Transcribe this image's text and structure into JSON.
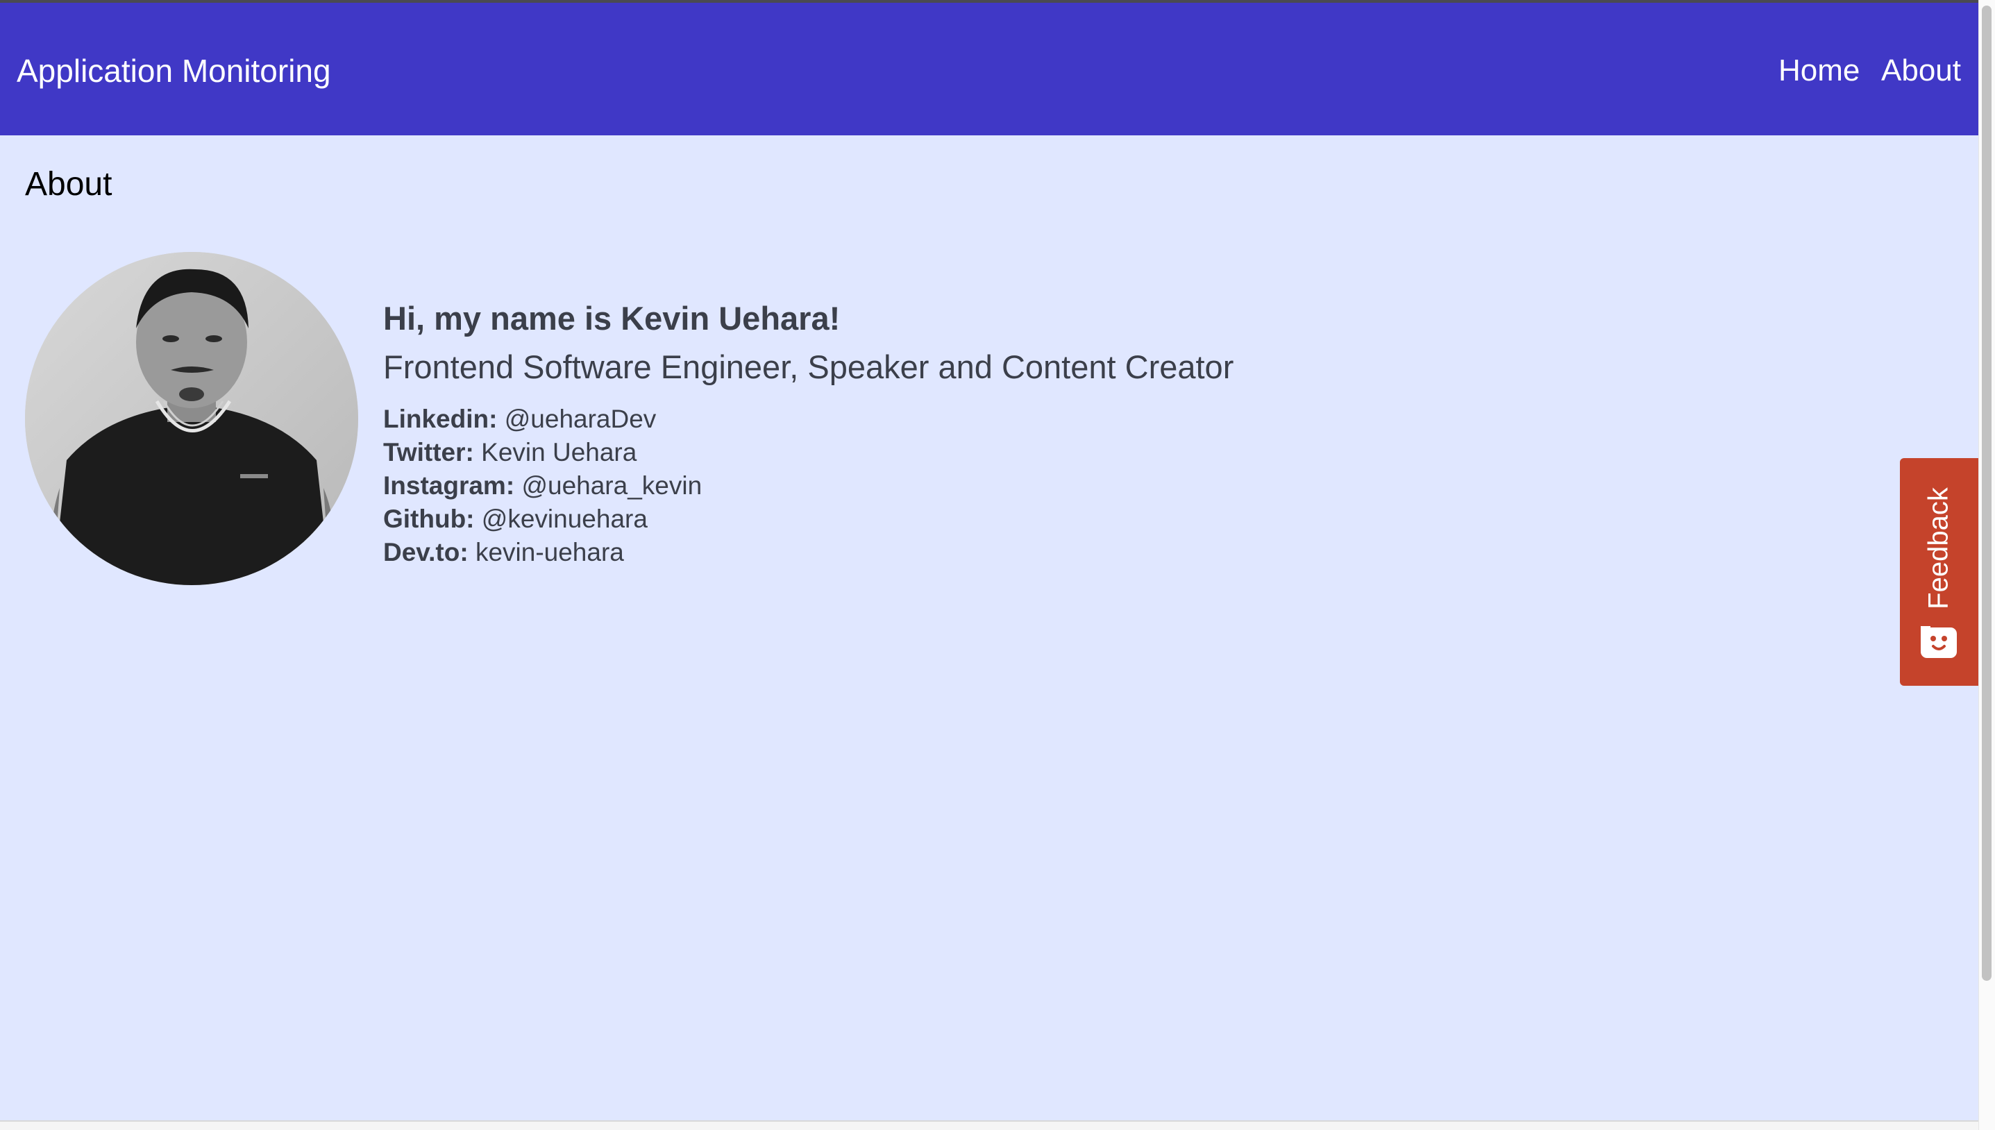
{
  "header": {
    "brand": "Application Monitoring",
    "nav": [
      {
        "label": "Home"
      },
      {
        "label": "About"
      }
    ],
    "background_color": "#4038c6"
  },
  "page": {
    "title": "About",
    "background_color": "#e0e7ff"
  },
  "profile": {
    "greeting": "Hi, my name is Kevin Uehara!",
    "role": "Frontend Software Engineer, Speaker and Content Creator",
    "avatar_icon": "profile-photo",
    "socials": [
      {
        "label": "Linkedin:",
        "value": "@ueharaDev"
      },
      {
        "label": "Twitter:",
        "value": "Kevin Uehara"
      },
      {
        "label": "Instagram:",
        "value": "@uehara_kevin"
      },
      {
        "label": "Github:",
        "value": "@kevinuehara"
      },
      {
        "label": "Dev.to:",
        "value": "kevin-uehara"
      }
    ]
  },
  "feedback": {
    "label": "Feedback",
    "icon": "chat-face-icon",
    "color": "#c5432b"
  }
}
